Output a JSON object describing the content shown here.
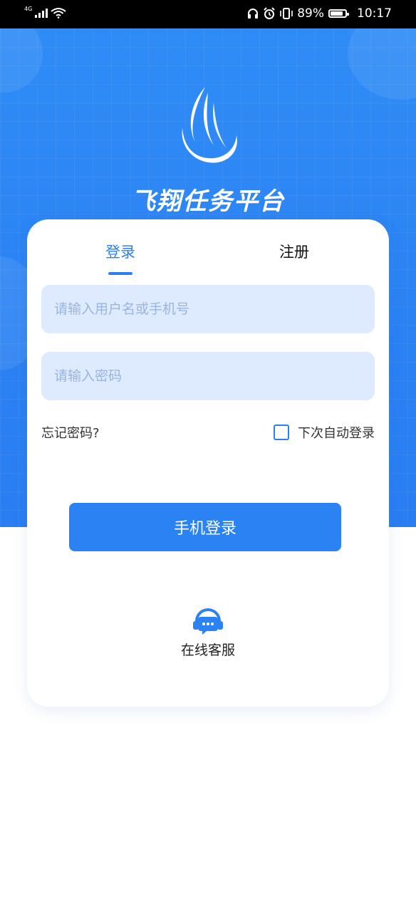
{
  "status_bar": {
    "network": "4G",
    "battery": "89%",
    "time": "10:17"
  },
  "brand": {
    "title": "飞翔任务平台",
    "logo_icon": "wing-flame-logo"
  },
  "tabs": [
    {
      "label": "登录",
      "active": true
    },
    {
      "label": "注册",
      "active": false
    }
  ],
  "form": {
    "username_placeholder": "请输入用户名或手机号",
    "password_placeholder": "请输入密码",
    "forgot_password": "忘记密码?",
    "remember_label": "下次自动登录",
    "remember_checked": false,
    "login_button": "手机登录"
  },
  "support": {
    "label": "在线客服",
    "icon": "headset-chat-icon"
  },
  "colors": {
    "primary": "#2b82f3",
    "input_bg": "#deeafd",
    "placeholder": "#9ab5df"
  }
}
